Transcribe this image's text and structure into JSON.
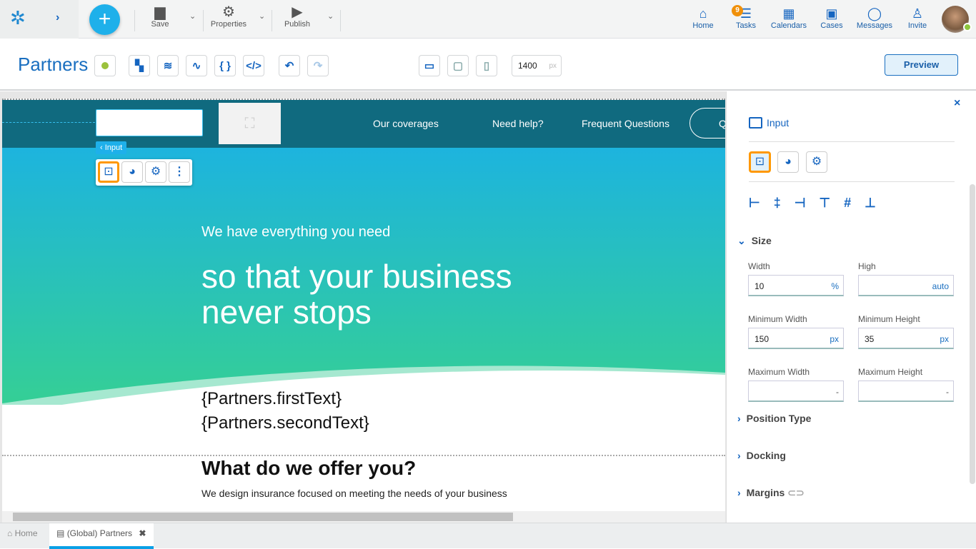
{
  "topbar": {
    "save": "Save",
    "properties": "Properties",
    "publish": "Publish",
    "nav": [
      {
        "label": "Home",
        "icon": "home-icon"
      },
      {
        "label": "Tasks",
        "icon": "tasks-icon",
        "badge": "9"
      },
      {
        "label": "Calendars",
        "icon": "calendar-icon"
      },
      {
        "label": "Cases",
        "icon": "briefcase-icon"
      },
      {
        "label": "Messages",
        "icon": "message-icon"
      },
      {
        "label": "Invite",
        "icon": "invite-icon"
      }
    ]
  },
  "toolbar": {
    "title": "Partners",
    "width_value": "1400",
    "width_unit": "px",
    "preview": "Preview"
  },
  "canvas": {
    "menu": [
      "Our coverages",
      "Need help?",
      "Frequent Questions",
      "Q"
    ],
    "input_tag": "Input",
    "hero_small": "We have everything you need",
    "hero_big1": "so that your business",
    "hero_big2": "never stops",
    "first": "{Partners.firstText}",
    "second": "{Partners.secondText}",
    "offer_title": "What do we offer you?",
    "offer_text": "We design insurance focused on meeting the needs of your business"
  },
  "panel": {
    "title": "Input",
    "size": "Size",
    "width_label": "Width",
    "width": "10",
    "width_unit": "%",
    "high_label": "High",
    "high_unit": "auto",
    "min_w_label": "Minimum Width",
    "min_w": "150",
    "min_w_unit": "px",
    "min_h_label": "Minimum Height",
    "min_h": "35",
    "min_h_unit": "px",
    "max_w_label": "Maximum Width",
    "max_w_unit": "-",
    "max_h_label": "Maximum Height",
    "max_h_unit": "-",
    "position": "Position Type",
    "docking": "Docking",
    "margins": "Margins"
  },
  "tabs": {
    "home": "Home",
    "partners": "(Global) Partners"
  },
  "colors": {
    "accent": "#1565c0",
    "header": "#106a7f",
    "selection": "#ff9800",
    "fab": "#1eb0ea"
  }
}
